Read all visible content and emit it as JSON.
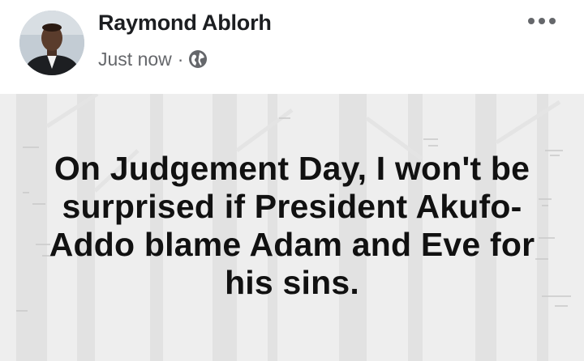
{
  "post": {
    "author": "Raymond Ablorh",
    "timestamp": "Just now",
    "separator": "·",
    "privacy_icon": "globe-icon",
    "menu_icon": "more-options-icon",
    "text": "On Judgement Day, I won't be surprised if President Akufo-Addo blame Adam and Eve for his sins.",
    "background": "forest-silhouette"
  },
  "colors": {
    "author": "#1c1e21",
    "meta": "#65676b",
    "content_bg": "#eeeeee",
    "post_text": "#111111"
  }
}
